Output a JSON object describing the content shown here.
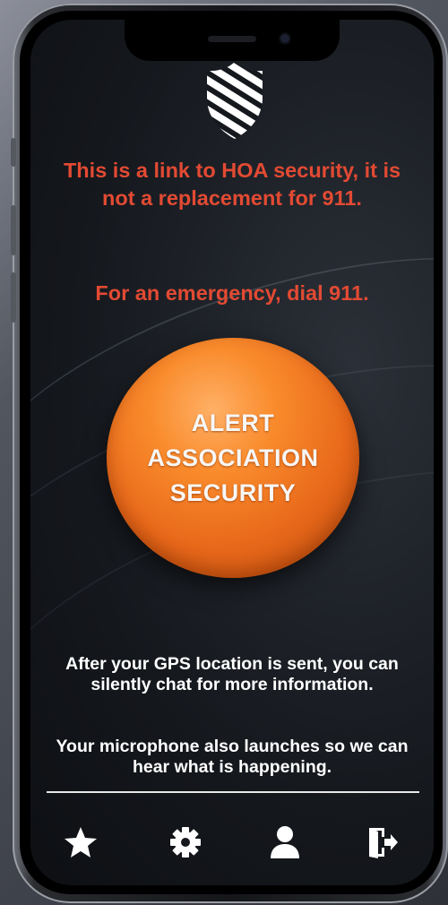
{
  "app": {
    "disclaimer": "This is a link to HOA security, it is not a replacement for 911.",
    "emergency_note": "For an emergency, dial 911.",
    "alert_button": {
      "line1": "ALERT",
      "line2": "ASSOCIATION",
      "line3": "SECURITY"
    },
    "info_gps": "After your GPS location is sent, you can silently chat for more information.",
    "info_mic": "Your microphone also launches so we can hear what is happening.",
    "colors": {
      "warning_text": "#e24a33",
      "alert_button": "#f07a22",
      "background": "#15181d"
    }
  },
  "tabbar": {
    "items": [
      {
        "icon": "star-icon"
      },
      {
        "icon": "gear-icon"
      },
      {
        "icon": "user-icon"
      },
      {
        "icon": "logout-icon"
      }
    ]
  }
}
